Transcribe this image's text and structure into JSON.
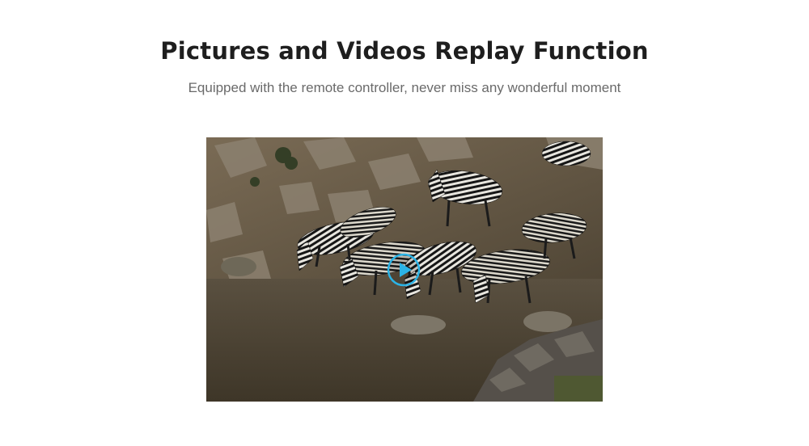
{
  "heading": {
    "title": "Pictures and Videos Replay Function",
    "subtitle": "Equipped with the remote controller, never miss any wonderful moment"
  },
  "video": {
    "thumbnail": "zebras-drinking-at-river",
    "play_icon": "play-circle-icon",
    "accent_color": "#2bb3e6"
  }
}
